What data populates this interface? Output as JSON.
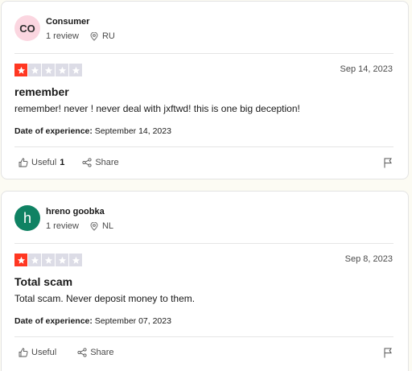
{
  "reviews": [
    {
      "avatar_initials": "CO",
      "author": "Consumer",
      "review_count": "1 review",
      "country": "RU",
      "date": "Sep 14, 2023",
      "rating": 1,
      "title": "remember",
      "body": "remember! never ! never deal with jxftwd! this is one big deception!",
      "experience_label": "Date of experience:",
      "experience_date": "September 14, 2023",
      "useful_label": "Useful",
      "useful_count": "1",
      "share_label": "Share"
    },
    {
      "avatar_initials": "h",
      "author": "hreno goobka",
      "review_count": "1 review",
      "country": "NL",
      "date": "Sep 8, 2023",
      "rating": 1,
      "title": "Total scam",
      "body": "Total scam. Never deposit money to them.",
      "experience_label": "Date of experience:",
      "experience_date": "September 07, 2023",
      "useful_label": "Useful",
      "useful_count": "",
      "share_label": "Share"
    }
  ],
  "colors": {
    "star_active": "#ff3722",
    "star_inactive": "#dcdce6",
    "avatar_1_bg": "#fbd6e0",
    "avatar_2_bg": "#0f8263",
    "page_bg": "#fcfbf3"
  },
  "icons": [
    "location-pin-icon",
    "star-icon",
    "thumbs-up-icon",
    "share-icon",
    "flag-icon"
  ]
}
